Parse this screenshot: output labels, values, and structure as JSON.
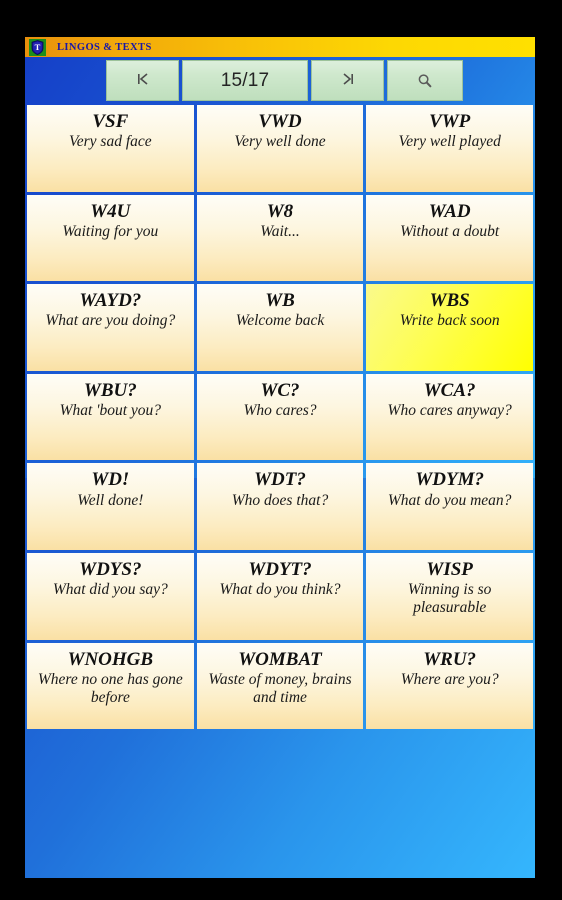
{
  "window": {
    "title": "LINGOS & TEXTS",
    "icon": "shield-badge-icon"
  },
  "colors": {
    "titlebar_start": "#e8900c",
    "titlebar_end": "#ffe000",
    "title_text": "#1717a8",
    "background_start": "#1540c8",
    "background_end": "#33b2fb",
    "card_start": "#fefdf7",
    "card_end": "#fae0a4",
    "selected_start": "#fafa8c",
    "selected_end": "#ffff00",
    "button_face": "#cfe8cd"
  },
  "toolbar": {
    "first_page_label": "|‹",
    "first_page_icon": "first-page-icon",
    "page_indicator": "15/17",
    "current_page": 15,
    "total_pages": 17,
    "last_page_label": "›|",
    "last_page_icon": "last-page-icon",
    "search_icon": "search-icon",
    "search_label": ""
  },
  "grid": {
    "columns": 3,
    "selected_index": 8,
    "cards": [
      {
        "abbr": "VSF",
        "meaning": "Very sad face"
      },
      {
        "abbr": "VWD",
        "meaning": "Very well done"
      },
      {
        "abbr": "VWP",
        "meaning": "Very well played"
      },
      {
        "abbr": "W4U",
        "meaning": "Waiting for you"
      },
      {
        "abbr": "W8",
        "meaning": "Wait..."
      },
      {
        "abbr": "WAD",
        "meaning": "Without a doubt"
      },
      {
        "abbr": "WAYD?",
        "meaning": "What are you doing?"
      },
      {
        "abbr": "WB",
        "meaning": "Welcome back"
      },
      {
        "abbr": "WBS",
        "meaning": "Write back soon"
      },
      {
        "abbr": "WBU?",
        "meaning": "What 'bout you?"
      },
      {
        "abbr": "WC?",
        "meaning": "Who cares?"
      },
      {
        "abbr": "WCA?",
        "meaning": "Who cares anyway?"
      },
      {
        "abbr": "WD!",
        "meaning": "Well done!"
      },
      {
        "abbr": "WDT?",
        "meaning": "Who does that?"
      },
      {
        "abbr": "WDYM?",
        "meaning": "What do you mean?"
      },
      {
        "abbr": "WDYS?",
        "meaning": "What did you say?"
      },
      {
        "abbr": "WDYT?",
        "meaning": "What do you think?"
      },
      {
        "abbr": "WISP",
        "meaning": "Winning is so pleasurable"
      },
      {
        "abbr": "WNOHGB",
        "meaning": "Where no one has gone before"
      },
      {
        "abbr": "WOMBAT",
        "meaning": "Waste of money, brains and time"
      },
      {
        "abbr": "WRU?",
        "meaning": "Where are you?"
      }
    ]
  }
}
